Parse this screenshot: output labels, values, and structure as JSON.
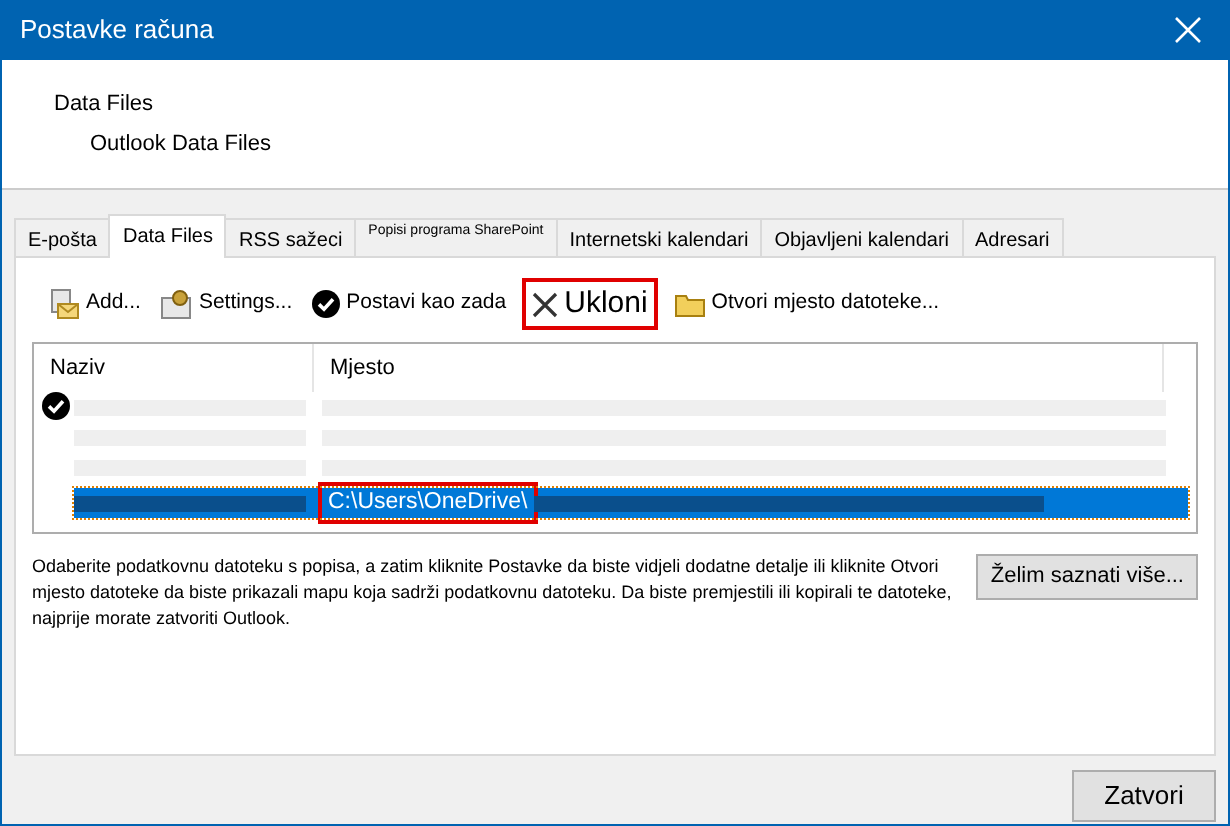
{
  "window": {
    "title": "Postavke računa"
  },
  "header": {
    "title": "Data Files",
    "subtitle": "Outlook Data Files"
  },
  "tabs": [
    {
      "label": "E-pošta",
      "selected": false
    },
    {
      "label": "Data Files",
      "selected": true
    },
    {
      "label": "RSS sažeci",
      "selected": false
    },
    {
      "label": "Popisi programa SharePoint",
      "selected": false,
      "kind": "small"
    },
    {
      "label": "Internetski kalendari",
      "selected": false
    },
    {
      "label": "Objavljeni kalendari",
      "selected": false
    },
    {
      "label": "Adresari",
      "selected": false
    }
  ],
  "toolbar": [
    {
      "label": "Add...",
      "kind": "add",
      "highlighted": false
    },
    {
      "label": "Settings...",
      "kind": "settings",
      "highlighted": false
    },
    {
      "label": "Postavi kao zada",
      "kind": "check",
      "highlighted": false
    },
    {
      "label": "Ukloni",
      "kind": "remove",
      "highlighted": true
    },
    {
      "label": "Otvori mjesto datoteke...",
      "kind": "folder",
      "highlighted": false
    }
  ],
  "table": {
    "columns": [
      "Naziv",
      "Mjesto"
    ],
    "rows": [
      {
        "default": true,
        "selected": false
      },
      {
        "default": false,
        "selected": false
      },
      {
        "default": false,
        "selected": false
      },
      {
        "default": false,
        "selected": true,
        "location": "C:\\Users\\OneDrive\\",
        "highlighted": true
      }
    ]
  },
  "help_text": "Odaberite podatkovnu datoteku s popisa, a zatim kliknite Postavke da biste vidjeli dodatne detalje ili kliknite Otvori mjesto datoteke da biste prikazali mapu koja sadrži podatkovnu datoteku. Da biste premjestili ili kopirali te datoteke, najprije morate zatvoriti Outlook.",
  "learn_more_button": "Želim saznati više...",
  "close_button": "Zatvori"
}
